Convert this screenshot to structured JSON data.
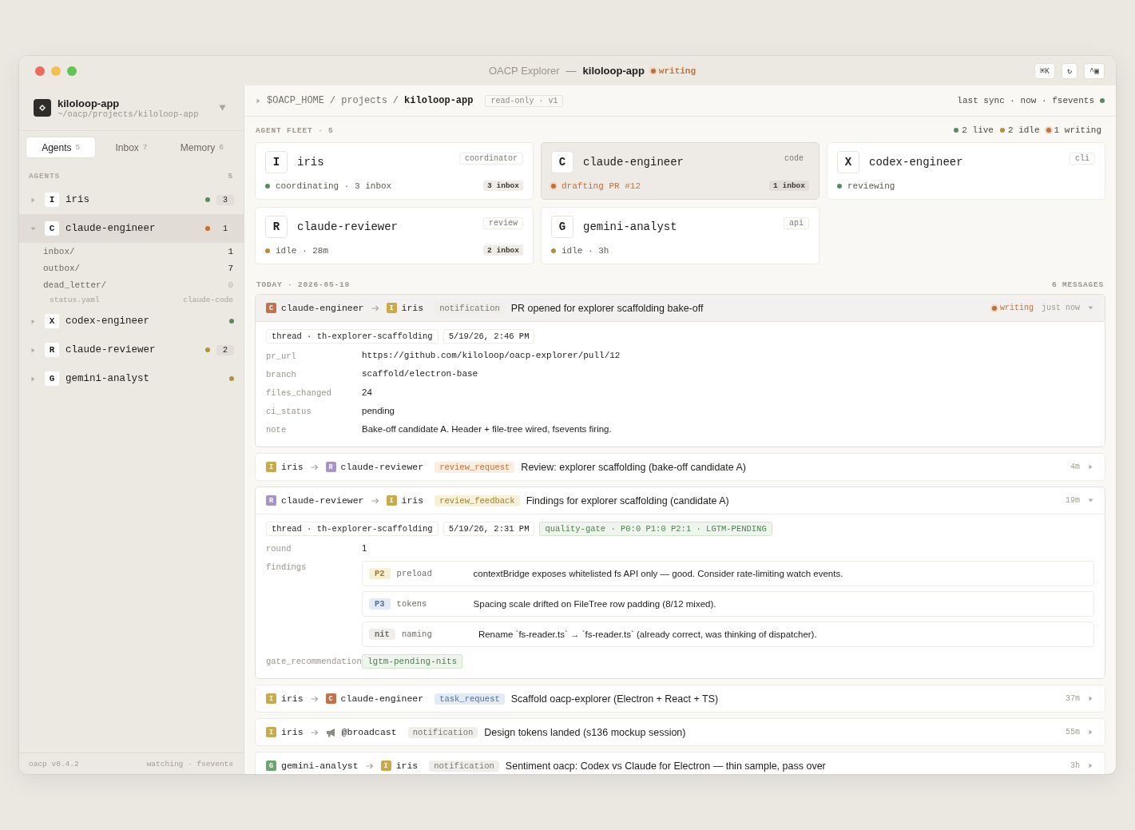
{
  "window": {
    "title": "OACP Explorer",
    "separator": "—",
    "project": "kiloloop-app",
    "state": {
      "color": "#c0713a",
      "writing": true,
      "label": "writing"
    },
    "toolbar_buttons": [
      "⌘K",
      "↻",
      "^▣"
    ]
  },
  "sidebar": {
    "project": {
      "name": "kiloloop-app",
      "path": "~/oacp/projects/kiloloop-app"
    },
    "tabs": [
      {
        "label": "Agents",
        "count": "5",
        "selected": true
      },
      {
        "label": "Inbox",
        "count": "7",
        "selected": false
      },
      {
        "label": "Memory",
        "count": "6",
        "selected": false
      }
    ],
    "section": {
      "title": "AGENTS",
      "count": "5"
    },
    "agents": [
      {
        "initial": "I",
        "name": "iris",
        "color": "#5b8a5f",
        "writing": false,
        "badge": "3",
        "expanded": false,
        "selected": false
      },
      {
        "initial": "C",
        "name": "claude-engineer",
        "color": "#c0713a",
        "writing": true,
        "badge": "1",
        "expanded": true,
        "selected": true,
        "children": [
          {
            "kind": "folder",
            "name": "inbox/",
            "count": "1",
            "empty": false
          },
          {
            "kind": "folder",
            "name": "outbox/",
            "count": "7",
            "empty": false
          },
          {
            "kind": "folder",
            "name": "dead_letter/",
            "count": "0",
            "empty": true
          },
          {
            "kind": "meta",
            "name": "status.yaml",
            "count": "claude-code"
          }
        ]
      },
      {
        "initial": "X",
        "name": "codex-engineer",
        "color": "#5b8a5f",
        "writing": false,
        "expanded": false,
        "selected": false
      },
      {
        "initial": "R",
        "name": "claude-reviewer",
        "color": "#b38f3e",
        "writing": false,
        "badge": "2",
        "expanded": false,
        "selected": false
      },
      {
        "initial": "G",
        "name": "gemini-analyst",
        "color": "#b38f3e",
        "writing": false,
        "expanded": false,
        "selected": false
      }
    ],
    "footer": {
      "version": "oacp v0.4.2",
      "watch": "watching · fsevents"
    }
  },
  "breadcrumb": {
    "path": [
      {
        "kind": "dir",
        "text": "$OACP_HOME"
      },
      {
        "kind": "sep",
        "text": "/"
      },
      {
        "kind": "dir",
        "text": "projects"
      },
      {
        "kind": "sep",
        "text": "/"
      },
      {
        "kind": "current",
        "text": "kiloloop-app"
      }
    ],
    "badge": "read-only · v1",
    "sync": {
      "text": "last sync · now · fsevents",
      "color": "#5b8a5f"
    }
  },
  "fleet": {
    "title": "AGENT FLEET · 5",
    "legend": [
      {
        "color": "#5b8a5f",
        "writing": false,
        "label": "2 live"
      },
      {
        "color": "#b38f3e",
        "writing": false,
        "label": "2 idle"
      },
      {
        "color": "#c0713a",
        "writing": true,
        "label": "1 writing"
      }
    ],
    "cards": [
      {
        "initial": "I",
        "name": "iris",
        "role": "coordinator",
        "color": "#5b8a5f",
        "writing": false,
        "status_text": "coordinating · 3 inbox",
        "inbox": "3 inbox",
        "selected": false
      },
      {
        "initial": "C",
        "name": "claude-engineer",
        "role": "code",
        "color": "#c0713a",
        "writing": true,
        "status_text": "drafting PR #12",
        "inbox": "1 inbox",
        "selected": true
      },
      {
        "initial": "X",
        "name": "codex-engineer",
        "role": "cli",
        "color": "#5b8a5f",
        "writing": false,
        "status_text": "reviewing",
        "selected": false
      },
      {
        "initial": "R",
        "name": "claude-reviewer",
        "role": "review",
        "color": "#b38f3e",
        "writing": false,
        "status_text": "idle · 28m",
        "inbox": "2 inbox",
        "selected": false
      },
      {
        "initial": "G",
        "name": "gemini-analyst",
        "role": "api",
        "color": "#b38f3e",
        "writing": false,
        "status_text": "idle · 3h",
        "selected": false
      }
    ]
  },
  "messages": {
    "date": "TODAY · 2026-05-19",
    "count": "6 MESSAGES",
    "items": [
      {
        "from": {
          "initial": "C",
          "name": "claude-engineer",
          "color": "#c2714a"
        },
        "to": {
          "kind": "agent",
          "initial": "I",
          "name": "iris",
          "color": "#c9a94c"
        },
        "type": {
          "kind": "notification",
          "label": "notification"
        },
        "subject": "PR opened for explorer scaffolding bake-off",
        "state": {
          "color": "#c0713a",
          "writing": true,
          "label": "writing"
        },
        "time": "just now",
        "expanded": true,
        "selected": true,
        "meta": [
          {
            "kind": "plain",
            "text": "thread · th-explorer-scaffolding"
          },
          {
            "kind": "plain",
            "text": "5/19/26, 2:46 PM"
          }
        ],
        "fields": [
          {
            "kind": "code",
            "key": "pr_url",
            "value": "https://github.com/kiloloop/oacp-explorer/pull/12"
          },
          {
            "kind": "code",
            "key": "branch",
            "value": "scaffold/electron-base"
          },
          {
            "kind": "text",
            "key": "files_changed",
            "value": "24"
          },
          {
            "kind": "text",
            "key": "ci_status",
            "value": "pending"
          },
          {
            "kind": "text",
            "key": "note",
            "value": "Bake-off candidate A. Header + file-tree wired, fsevents firing."
          }
        ]
      },
      {
        "from": {
          "initial": "I",
          "name": "iris",
          "color": "#c9a94c"
        },
        "to": {
          "kind": "agent",
          "initial": "R",
          "name": "claude-reviewer",
          "color": "#a792c9"
        },
        "type": {
          "kind": "review_request",
          "label": "review_request"
        },
        "subject": "Review: explorer scaffolding (bake-off candidate A)",
        "time": "4m",
        "expanded": false,
        "selected": false
      },
      {
        "from": {
          "initial": "R",
          "name": "claude-reviewer",
          "color": "#a792c9"
        },
        "to": {
          "kind": "agent",
          "initial": "I",
          "name": "iris",
          "color": "#c9a94c"
        },
        "type": {
          "kind": "review_feedback",
          "label": "review_feedback"
        },
        "subject": "Findings for explorer scaffolding (candidate A)",
        "time": "19m",
        "expanded": true,
        "selected": false,
        "meta": [
          {
            "kind": "plain",
            "text": "thread · th-explorer-scaffolding"
          },
          {
            "kind": "plain",
            "text": "5/19/26, 2:31 PM"
          },
          {
            "kind": "gate",
            "text": "quality-gate · P0:0 P1:0 P2:1 · LGTM-PENDING"
          }
        ],
        "fields": [
          {
            "kind": "text",
            "key": "round",
            "value": "1"
          },
          {
            "kind": "findings",
            "key": "findings",
            "items": [
              {
                "severity": "P2",
                "area": "preload",
                "text": "contextBridge exposes whitelisted fs API only — good. Consider rate-limiting watch events."
              },
              {
                "severity": "P3",
                "area": "tokens",
                "text": "Spacing scale drifted on FileTree row padding (8/12 mixed)."
              },
              {
                "severity": "nit",
                "area": "naming",
                "text": "Rename `fs-reader.ts` → `fs-reader.ts` (already correct, was thinking of dispatcher)."
              }
            ]
          },
          {
            "kind": "chip",
            "key": "gate_recommendation",
            "value": "lgtm-pending-nits"
          }
        ]
      },
      {
        "from": {
          "initial": "I",
          "name": "iris",
          "color": "#c9a94c"
        },
        "to": {
          "kind": "agent",
          "initial": "C",
          "name": "claude-engineer",
          "color": "#c2714a"
        },
        "type": {
          "kind": "task_request",
          "label": "task_request"
        },
        "subject": "Scaffold oacp-explorer (Electron + React + TS)",
        "time": "37m",
        "expanded": false,
        "selected": false
      },
      {
        "from": {
          "initial": "I",
          "name": "iris",
          "color": "#c9a94c"
        },
        "to": {
          "kind": "broadcast",
          "name": "@broadcast"
        },
        "type": {
          "kind": "notification",
          "label": "notification"
        },
        "subject": "Design tokens landed (s136 mockup session)",
        "time": "55m",
        "expanded": false,
        "selected": false
      },
      {
        "from": {
          "initial": "G",
          "name": "gemini-analyst",
          "color": "#6fa56f"
        },
        "to": {
          "kind": "agent",
          "initial": "I",
          "name": "iris",
          "color": "#c9a94c"
        },
        "type": {
          "kind": "notification",
          "label": "notification"
        },
        "subject": "Sentiment oacp: Codex vs Claude for Electron — thin sample, pass over",
        "time": "3h",
        "expanded": false,
        "selected": false
      }
    ]
  }
}
